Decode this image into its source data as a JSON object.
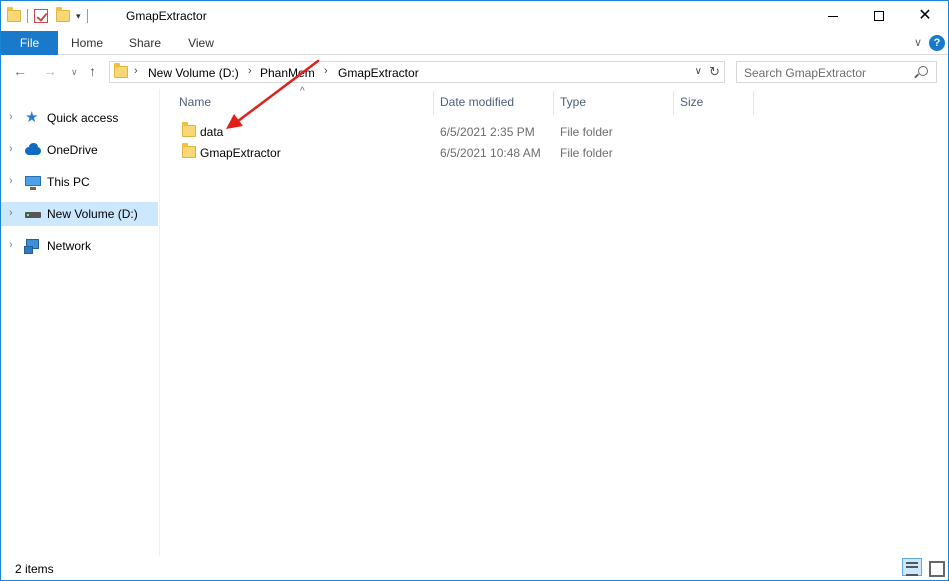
{
  "window": {
    "title": "GmapExtractor"
  },
  "ribbon": {
    "tabs": [
      {
        "label": "File"
      },
      {
        "label": "Home"
      },
      {
        "label": "Share"
      },
      {
        "label": "View"
      }
    ],
    "help_label": "?"
  },
  "address": {
    "crumbs": [
      "New Volume (D:)",
      "PhanMem",
      "GmapExtractor"
    ]
  },
  "search": {
    "placeholder": "Search GmapExtractor"
  },
  "navpane": {
    "items": [
      {
        "label": "Quick access",
        "icon": "star-icon"
      },
      {
        "label": "OneDrive",
        "icon": "cloud-icon"
      },
      {
        "label": "This PC",
        "icon": "computer-icon"
      },
      {
        "label": "New Volume (D:)",
        "icon": "drive-icon",
        "selected": true
      },
      {
        "label": "Network",
        "icon": "network-icon"
      }
    ]
  },
  "columns": {
    "name": "Name",
    "date": "Date modified",
    "type": "Type",
    "size": "Size"
  },
  "files": [
    {
      "name": "data",
      "date": "6/5/2021 2:35 PM",
      "type": "File folder"
    },
    {
      "name": "GmapExtractor",
      "date": "6/5/2021 10:48 AM",
      "type": "File folder"
    }
  ],
  "status": {
    "item_count": "2 items"
  },
  "colors": {
    "accent": "#1979ca",
    "selection": "#cce8ff",
    "annotation_arrow": "#e0201b"
  }
}
